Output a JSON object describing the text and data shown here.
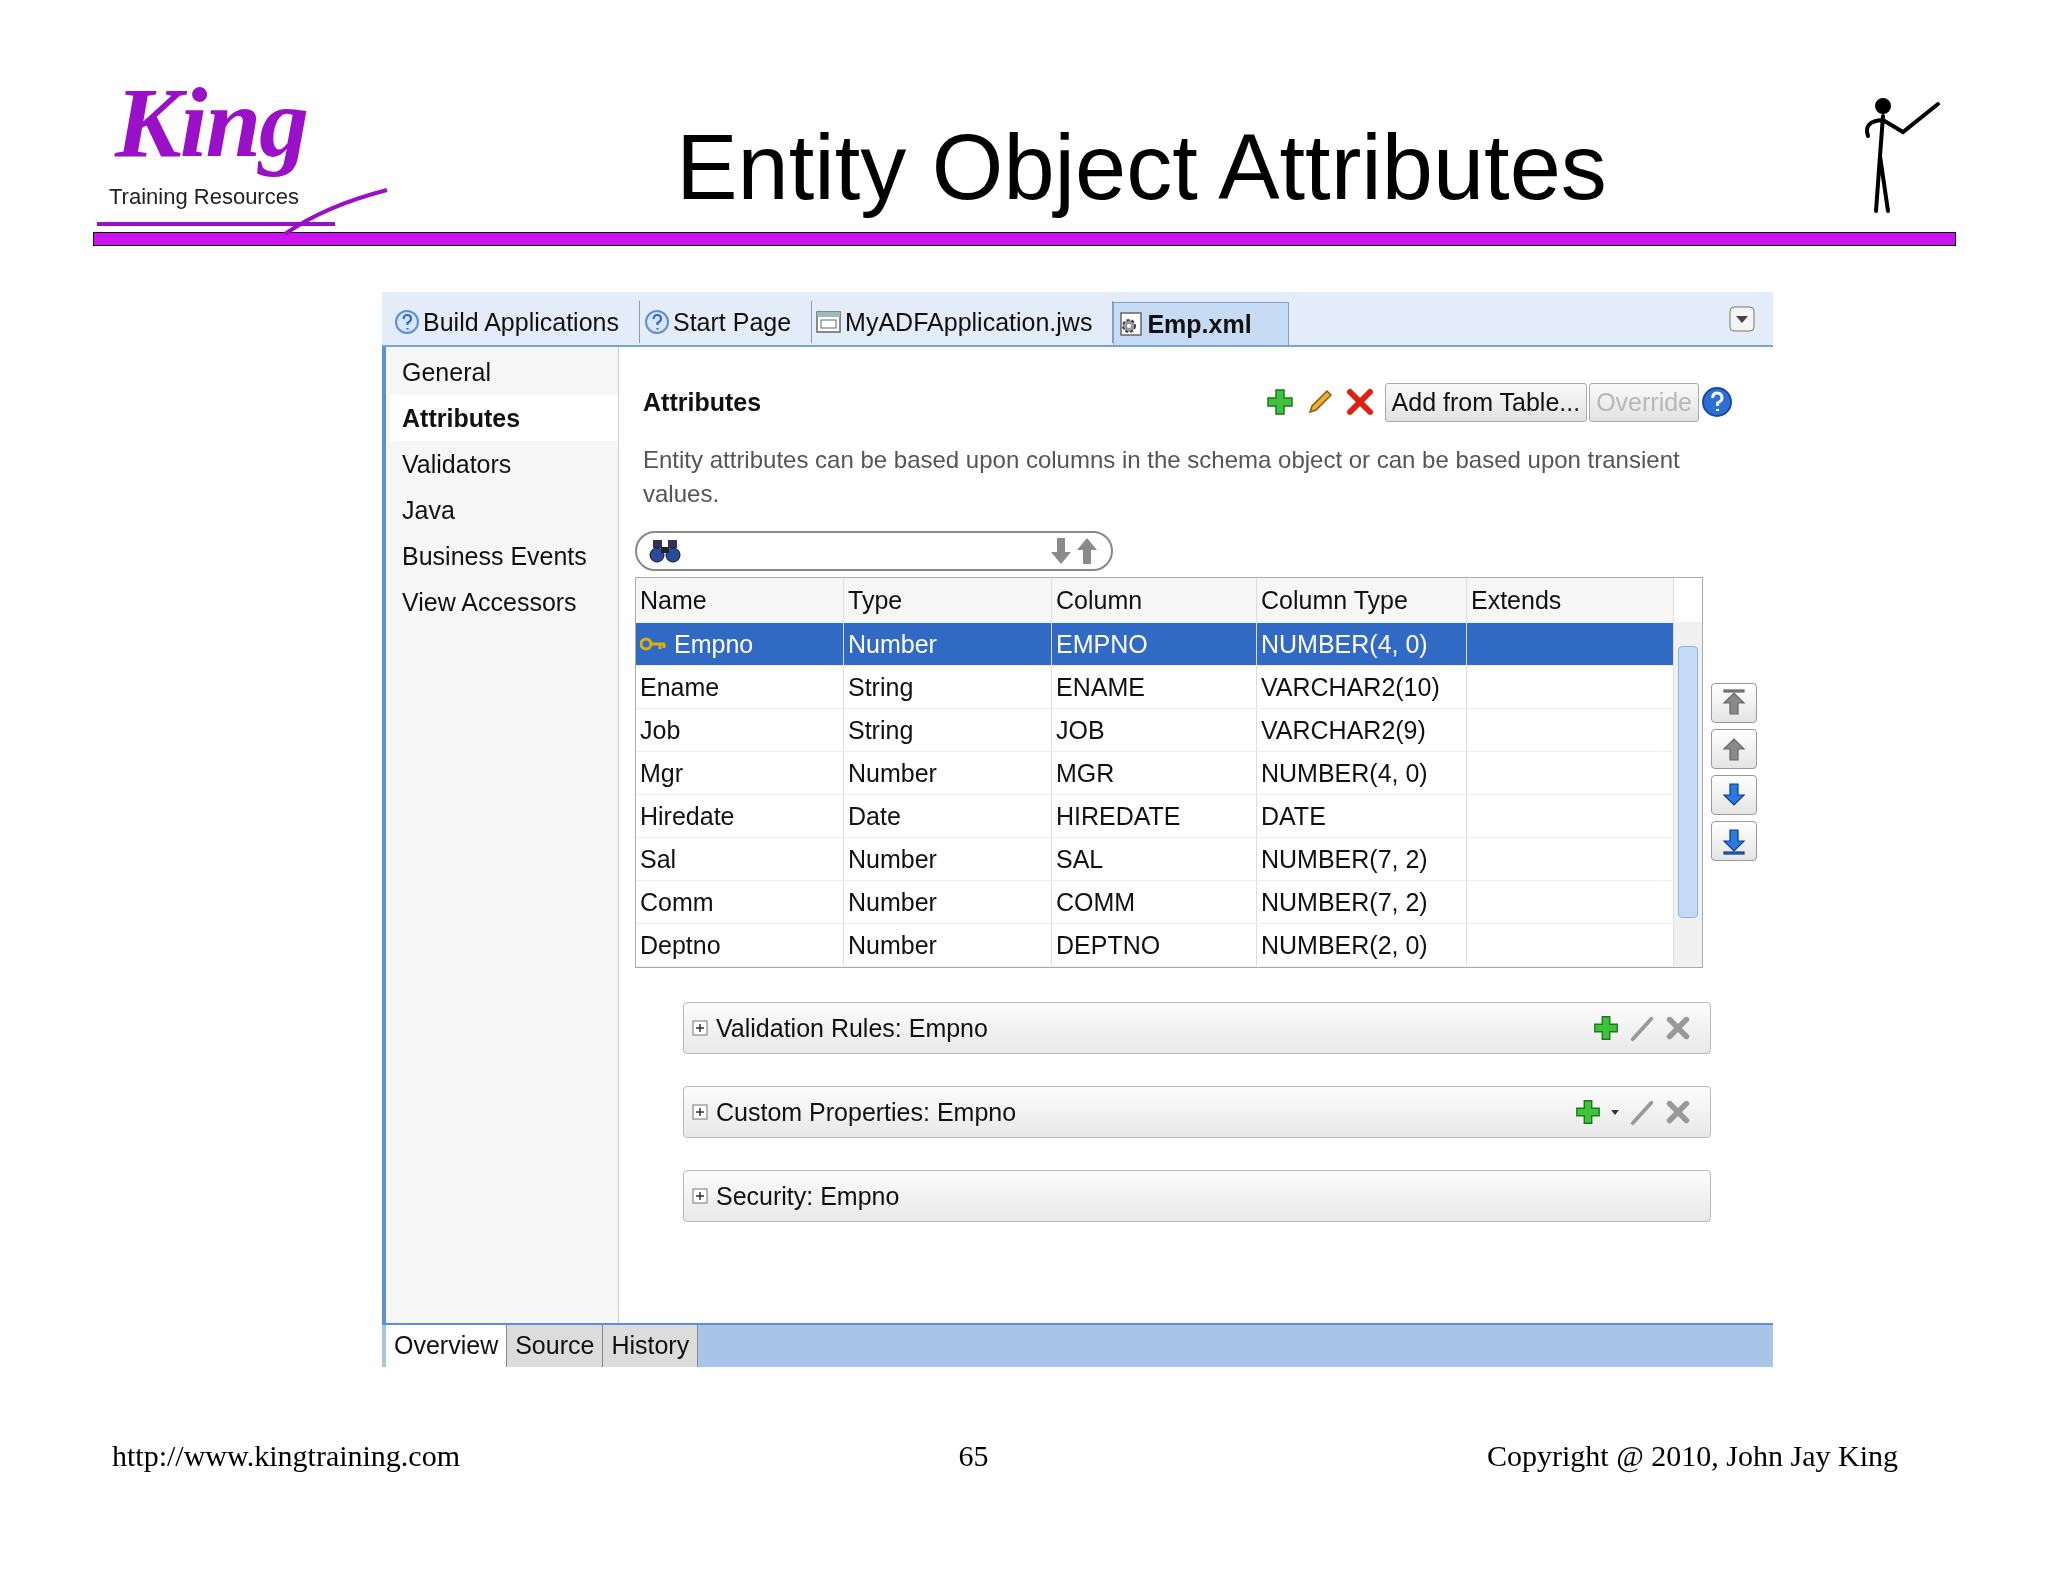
{
  "slide": {
    "logo": {
      "name": "King",
      "tagline": "Training Resources"
    },
    "title": "Entity Object Attributes"
  },
  "window": {
    "tabs": [
      {
        "label": "Build Applications",
        "kind": "help",
        "selected": false
      },
      {
        "label": "Start Page",
        "kind": "help",
        "selected": false
      },
      {
        "label": "MyADFApplication.jws",
        "kind": "workspace",
        "selected": false
      },
      {
        "label": "Emp.xml",
        "kind": "xml",
        "selected": true
      }
    ],
    "sidebar": {
      "items": [
        {
          "label": "General",
          "selected": false
        },
        {
          "label": "Attributes",
          "selected": true
        },
        {
          "label": "Validators",
          "selected": false
        },
        {
          "label": "Java",
          "selected": false
        },
        {
          "label": "Business Events",
          "selected": false
        },
        {
          "label": "View Accessors",
          "selected": false
        }
      ]
    },
    "section_title": "Attributes",
    "toolbar_buttons": [
      {
        "label": "Add from Table...",
        "disabled": false
      },
      {
        "label": "Override",
        "disabled": true
      }
    ],
    "description": "Entity attributes can be based upon columns in the schema object or can be based upon transient values.",
    "table": {
      "columns": [
        "Name",
        "Type",
        "Column",
        "Column Type",
        "Extends"
      ],
      "rows": [
        {
          "cells": [
            "Empno",
            "Number",
            "EMPNO",
            "NUMBER(4, 0)",
            ""
          ],
          "primary_key": true,
          "selected": true
        },
        {
          "cells": [
            "Ename",
            "String",
            "ENAME",
            "VARCHAR2(10)",
            ""
          ],
          "primary_key": false,
          "selected": false
        },
        {
          "cells": [
            "Job",
            "String",
            "JOB",
            "VARCHAR2(9)",
            ""
          ],
          "primary_key": false,
          "selected": false
        },
        {
          "cells": [
            "Mgr",
            "Number",
            "MGR",
            "NUMBER(4, 0)",
            ""
          ],
          "primary_key": false,
          "selected": false
        },
        {
          "cells": [
            "Hiredate",
            "Date",
            "HIREDATE",
            "DATE",
            ""
          ],
          "primary_key": false,
          "selected": false
        },
        {
          "cells": [
            "Sal",
            "Number",
            "SAL",
            "NUMBER(7, 2)",
            ""
          ],
          "primary_key": false,
          "selected": false
        },
        {
          "cells": [
            "Comm",
            "Number",
            "COMM",
            "NUMBER(7, 2)",
            ""
          ],
          "primary_key": false,
          "selected": false
        },
        {
          "cells": [
            "Deptno",
            "Number",
            "DEPTNO",
            "NUMBER(2, 0)",
            ""
          ],
          "primary_key": false,
          "selected": false
        }
      ]
    },
    "move_buttons": [
      {
        "kind": "top",
        "disabled": true
      },
      {
        "kind": "up",
        "disabled": true
      },
      {
        "kind": "down",
        "disabled": false
      },
      {
        "kind": "bottom",
        "disabled": false
      }
    ],
    "panels": [
      {
        "label": "Validation Rules: Empno",
        "actions": true,
        "add_menu": false
      },
      {
        "label": "Custom Properties: Empno",
        "actions": true,
        "add_menu": true
      },
      {
        "label": "Security: Empno",
        "actions": false,
        "add_menu": false
      }
    ],
    "bottom_tabs": [
      {
        "label": "Overview",
        "selected": true
      },
      {
        "label": "Source",
        "selected": false
      },
      {
        "label": "History",
        "selected": false
      }
    ]
  },
  "footer": {
    "url": "http://www.kingtraining.com",
    "page": "65",
    "copyright": "Copyright @ 2010, John Jay King"
  }
}
